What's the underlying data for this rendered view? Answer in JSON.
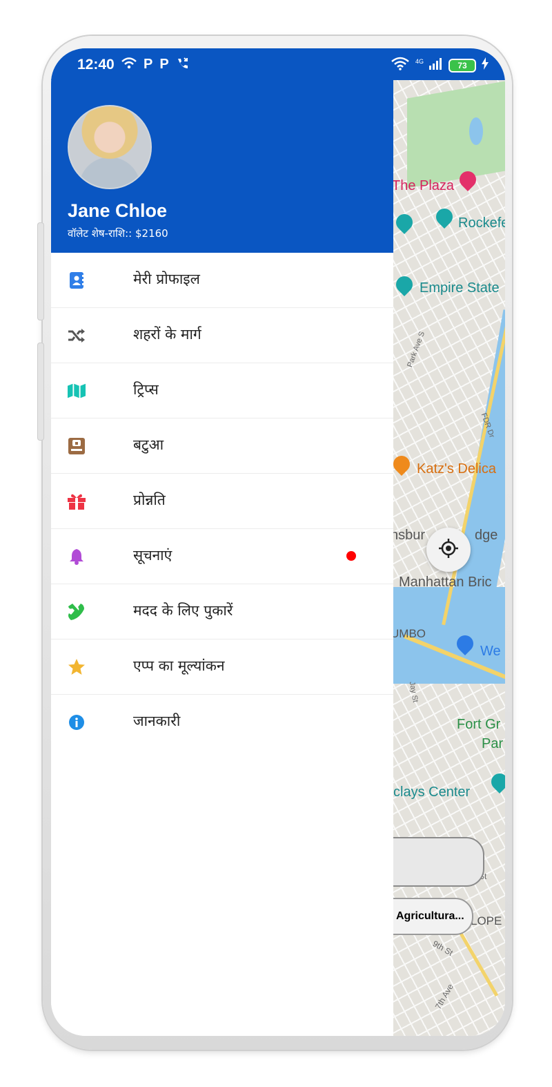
{
  "status_bar": {
    "time": "12:40",
    "network": "4G",
    "battery": "73"
  },
  "drawer": {
    "user": {
      "name": "Jane Chloe",
      "wallet_label": "वॉलेट शेष-राशि:: $2160"
    },
    "menu": [
      {
        "label": "मेरी प्रोफाइल",
        "icon": "profile-icon",
        "color": "#2f7ee8"
      },
      {
        "label": "शहरों के मार्ग",
        "icon": "shuffle-icon",
        "color": "#555555"
      },
      {
        "label": "ट्रिप्स",
        "icon": "map-icon",
        "color": "#16c3b4"
      },
      {
        "label": "बटुआ",
        "icon": "wallet-icon",
        "color": "#9c6b43"
      },
      {
        "label": "प्रोन्नति",
        "icon": "gift-icon",
        "color": "#ee3344"
      },
      {
        "label": "सूचनाएं",
        "icon": "bell-icon",
        "color": "#b14bd6"
      },
      {
        "label": "मदद के लिए पुकारें",
        "icon": "phone-icon",
        "color": "#2fbd4a"
      },
      {
        "label": "एप्प का मूल्यांकन",
        "icon": "star-icon",
        "color": "#f2b530"
      },
      {
        "label": "जानकारी",
        "icon": "info-icon",
        "color": "#1e8ee6"
      }
    ]
  },
  "map": {
    "labels": {
      "plaza": "The Plaza",
      "rockefeller": "Rockefe",
      "empire": "Empire State",
      "park_ave": "Park Ave S",
      "fdr": "FDR Dr",
      "katz": "Katz's Delica",
      "williamsburg": "nsbur",
      "williamsburg2": "dge",
      "manhattan": "Manhattan Bric",
      "dumbo": "UMBO",
      "we": "We",
      "jay": "Jay St",
      "fort_greene": "Fort Gr",
      "fort_greene2": "Par",
      "barclays": "clays Center",
      "st": "St",
      "lope": "LOPE",
      "ninth": "9th St",
      "seventh": "7th Ave"
    },
    "card_label": "Agricultura..."
  }
}
